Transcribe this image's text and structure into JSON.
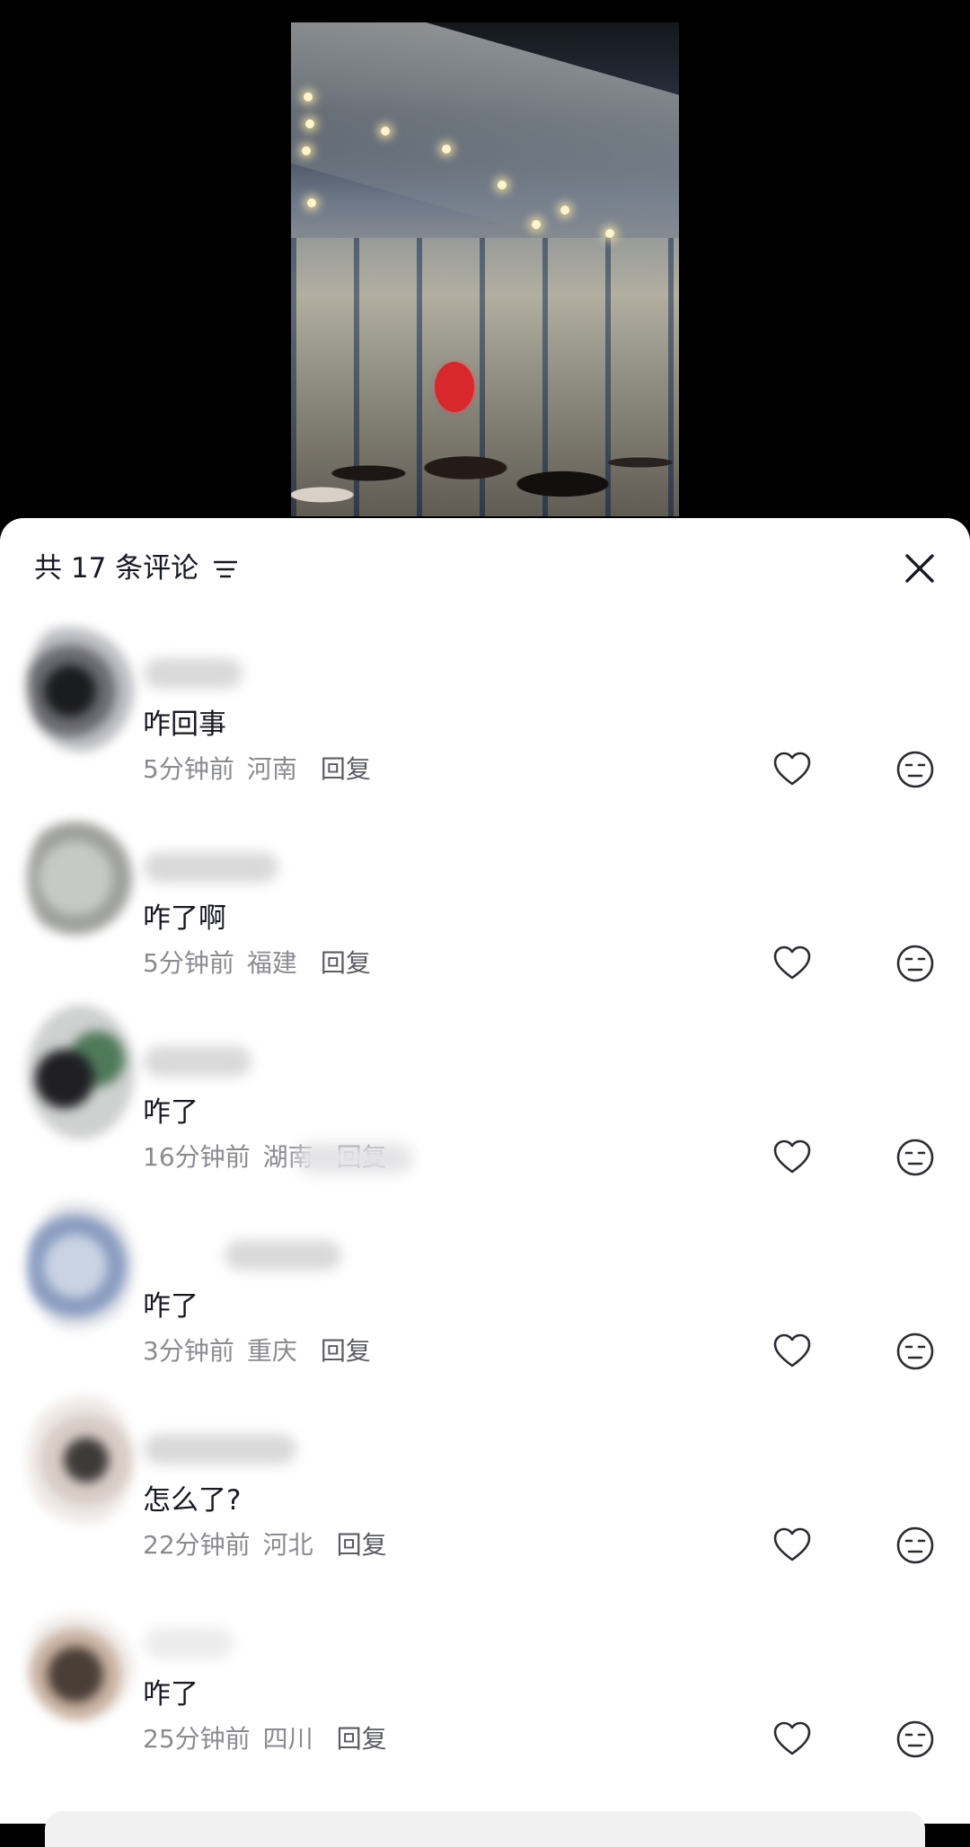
{
  "header": {
    "comment_count_label": "共 17 条评论",
    "sort_icon": "sort-lines-icon",
    "close_icon": "close-icon"
  },
  "comments": [
    {
      "text": "咋回事",
      "time": "5分钟前",
      "location": "河南",
      "reply": "回复"
    },
    {
      "text": "咋了啊",
      "time": "5分钟前",
      "location": "福建",
      "reply": "回复"
    },
    {
      "text": "咋了",
      "time": "16分钟前",
      "location": "湖南",
      "reply": "回复"
    },
    {
      "text": "咋了",
      "time": "3分钟前",
      "location": "重庆",
      "reply": "回复"
    },
    {
      "text": "怎么了?",
      "time": "22分钟前",
      "location": "河北",
      "reply": "回复"
    },
    {
      "text": "咋了",
      "time": "25分钟前",
      "location": "四川",
      "reply": "回复"
    }
  ],
  "icons": {
    "like": "heart-outline-icon",
    "dislike": "meh-face-icon"
  },
  "colors": {
    "text_primary": "#161823",
    "text_secondary": "#8a8b91",
    "background": "#ffffff"
  }
}
